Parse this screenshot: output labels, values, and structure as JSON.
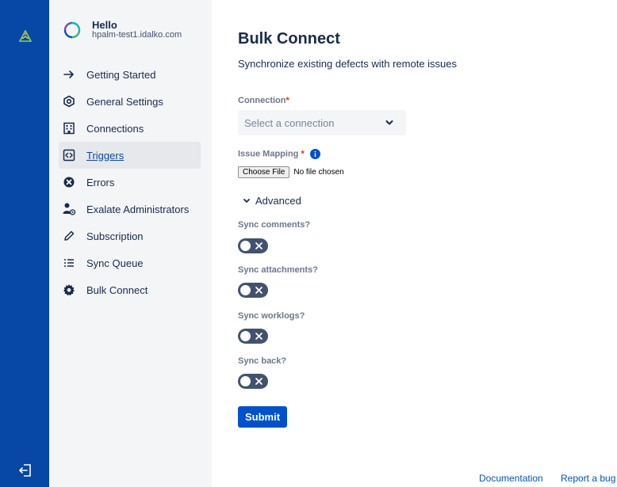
{
  "profile": {
    "greeting": "Hello",
    "host": "hpalm-test1.idalko.com"
  },
  "sidebar": {
    "items": [
      {
        "label": "Getting Started",
        "icon": "arrow-right-icon"
      },
      {
        "label": "General Settings",
        "icon": "settings-hexagon-icon"
      },
      {
        "label": "Connections",
        "icon": "building-icon"
      },
      {
        "label": "Triggers",
        "icon": "code-brackets-icon",
        "active": true
      },
      {
        "label": "Errors",
        "icon": "error-circle-icon"
      },
      {
        "label": "Exalate Administrators",
        "icon": "admin-user-icon"
      },
      {
        "label": "Subscription",
        "icon": "pencil-icon"
      },
      {
        "label": "Sync Queue",
        "icon": "list-icon"
      },
      {
        "label": "Bulk Connect",
        "icon": "gear-icon"
      }
    ]
  },
  "main": {
    "title": "Bulk Connect",
    "subtitle": "Synchronize existing defects with remote issues",
    "connection": {
      "label": "Connection",
      "required_mark": "*",
      "placeholder": "Select a connection"
    },
    "issue_mapping": {
      "label": "Issue Mapping",
      "required_mark": "*",
      "choose_file": "Choose File",
      "no_file": "No file chosen"
    },
    "advanced_label": "Advanced",
    "toggles": [
      {
        "label": "Sync comments?",
        "checked": false
      },
      {
        "label": "Sync attachments?",
        "checked": false
      },
      {
        "label": "Sync worklogs?",
        "checked": false
      },
      {
        "label": "Sync back?",
        "checked": false
      }
    ],
    "submit_label": "Submit"
  },
  "footer": {
    "documentation": "Documentation",
    "report_bug": "Report a bug"
  },
  "colors": {
    "global_bar": "#0747a6",
    "sidebar_bg": "#f4f5f7",
    "primary": "#0052cc",
    "toggle_off": "#42526e",
    "required": "#de350b"
  }
}
